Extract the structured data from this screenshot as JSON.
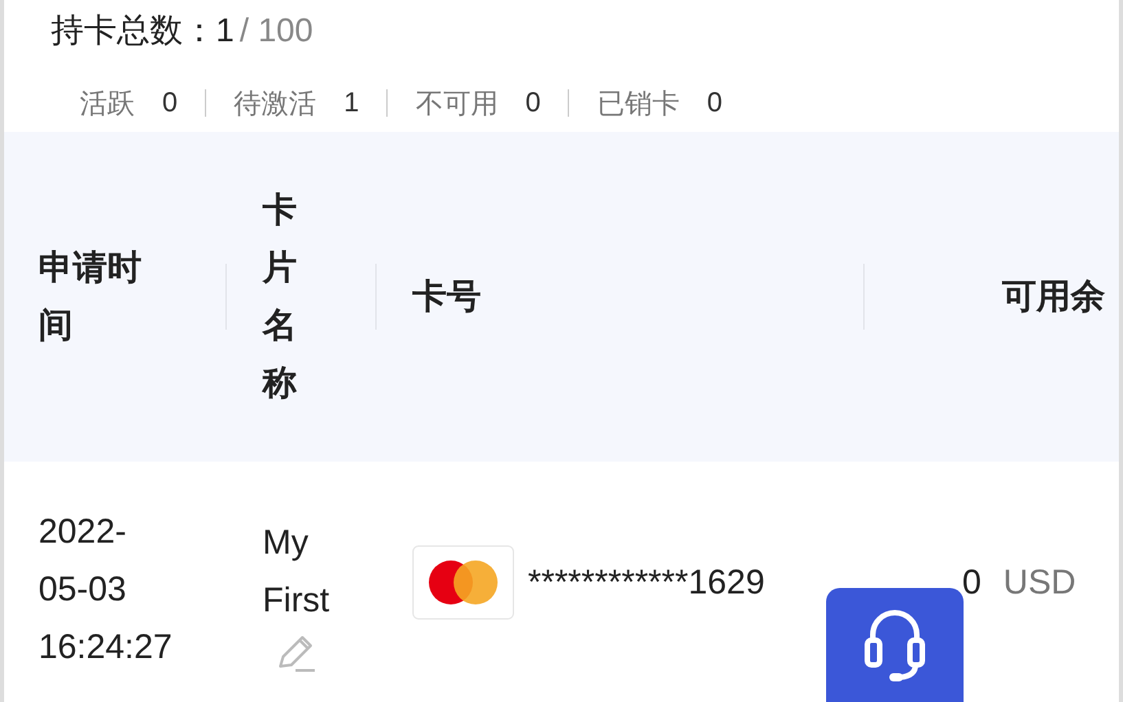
{
  "summary": {
    "label": "持卡总数：",
    "count": "1",
    "total": "/ 100"
  },
  "stats": [
    {
      "label": "活跃",
      "value": "0"
    },
    {
      "label": "待激活",
      "value": "1"
    },
    {
      "label": "不可用",
      "value": "0"
    },
    {
      "label": "已销卡",
      "value": "0"
    }
  ],
  "table": {
    "columns": [
      "申请时间",
      "卡片名称",
      "卡号",
      "可用余"
    ],
    "rows": [
      {
        "apply_time": "2022-05-03 16:24:27",
        "card_name": "My First",
        "card_number": "************1629",
        "balance": "0",
        "currency": "USD"
      }
    ]
  }
}
